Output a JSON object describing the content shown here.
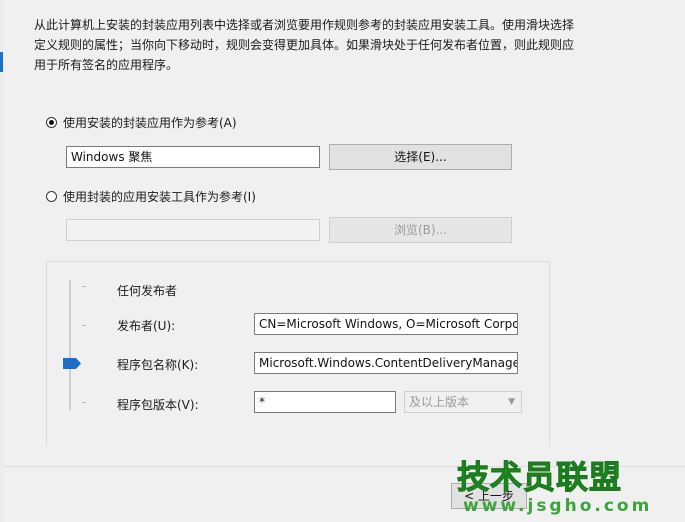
{
  "description": "从此计算机上安装的封装应用列表中选择或者浏览要用作规则参考的封装应用安装工具。使用滑块选择定义规则的属性；当你向下移动时，规则会变得更加具体。如果滑块处于任何发布者位置，则此规则应用于所有签名的应用程序。",
  "option_installed": {
    "label": "使用安装的封装应用作为参考(A)",
    "selected": true,
    "value": "Windows 聚焦",
    "button": "选择(E)..."
  },
  "option_installer": {
    "label": "使用封装的应用安装工具作为参考(I)",
    "selected": false,
    "value": "",
    "button": "浏览(B)..."
  },
  "slider": {
    "levels": [
      "任何发布者",
      "发布者(U):",
      "程序包名称(K):",
      "程序包版本(V):"
    ],
    "selected_level": "程序包名称(K):"
  },
  "fields": {
    "publisher": "CN=Microsoft Windows, O=Microsoft Corpora",
    "package_name": "Microsoft.Windows.ContentDeliveryManager",
    "package_version": "*",
    "version_mode": "及以上版本"
  },
  "footer": {
    "back_button": "< 上一步"
  },
  "watermark": {
    "title": "技术员联盟",
    "url": "www.jsgho.com"
  },
  "colors": {
    "accent": "#1b6fc8",
    "watermark": "#2ba82f"
  }
}
